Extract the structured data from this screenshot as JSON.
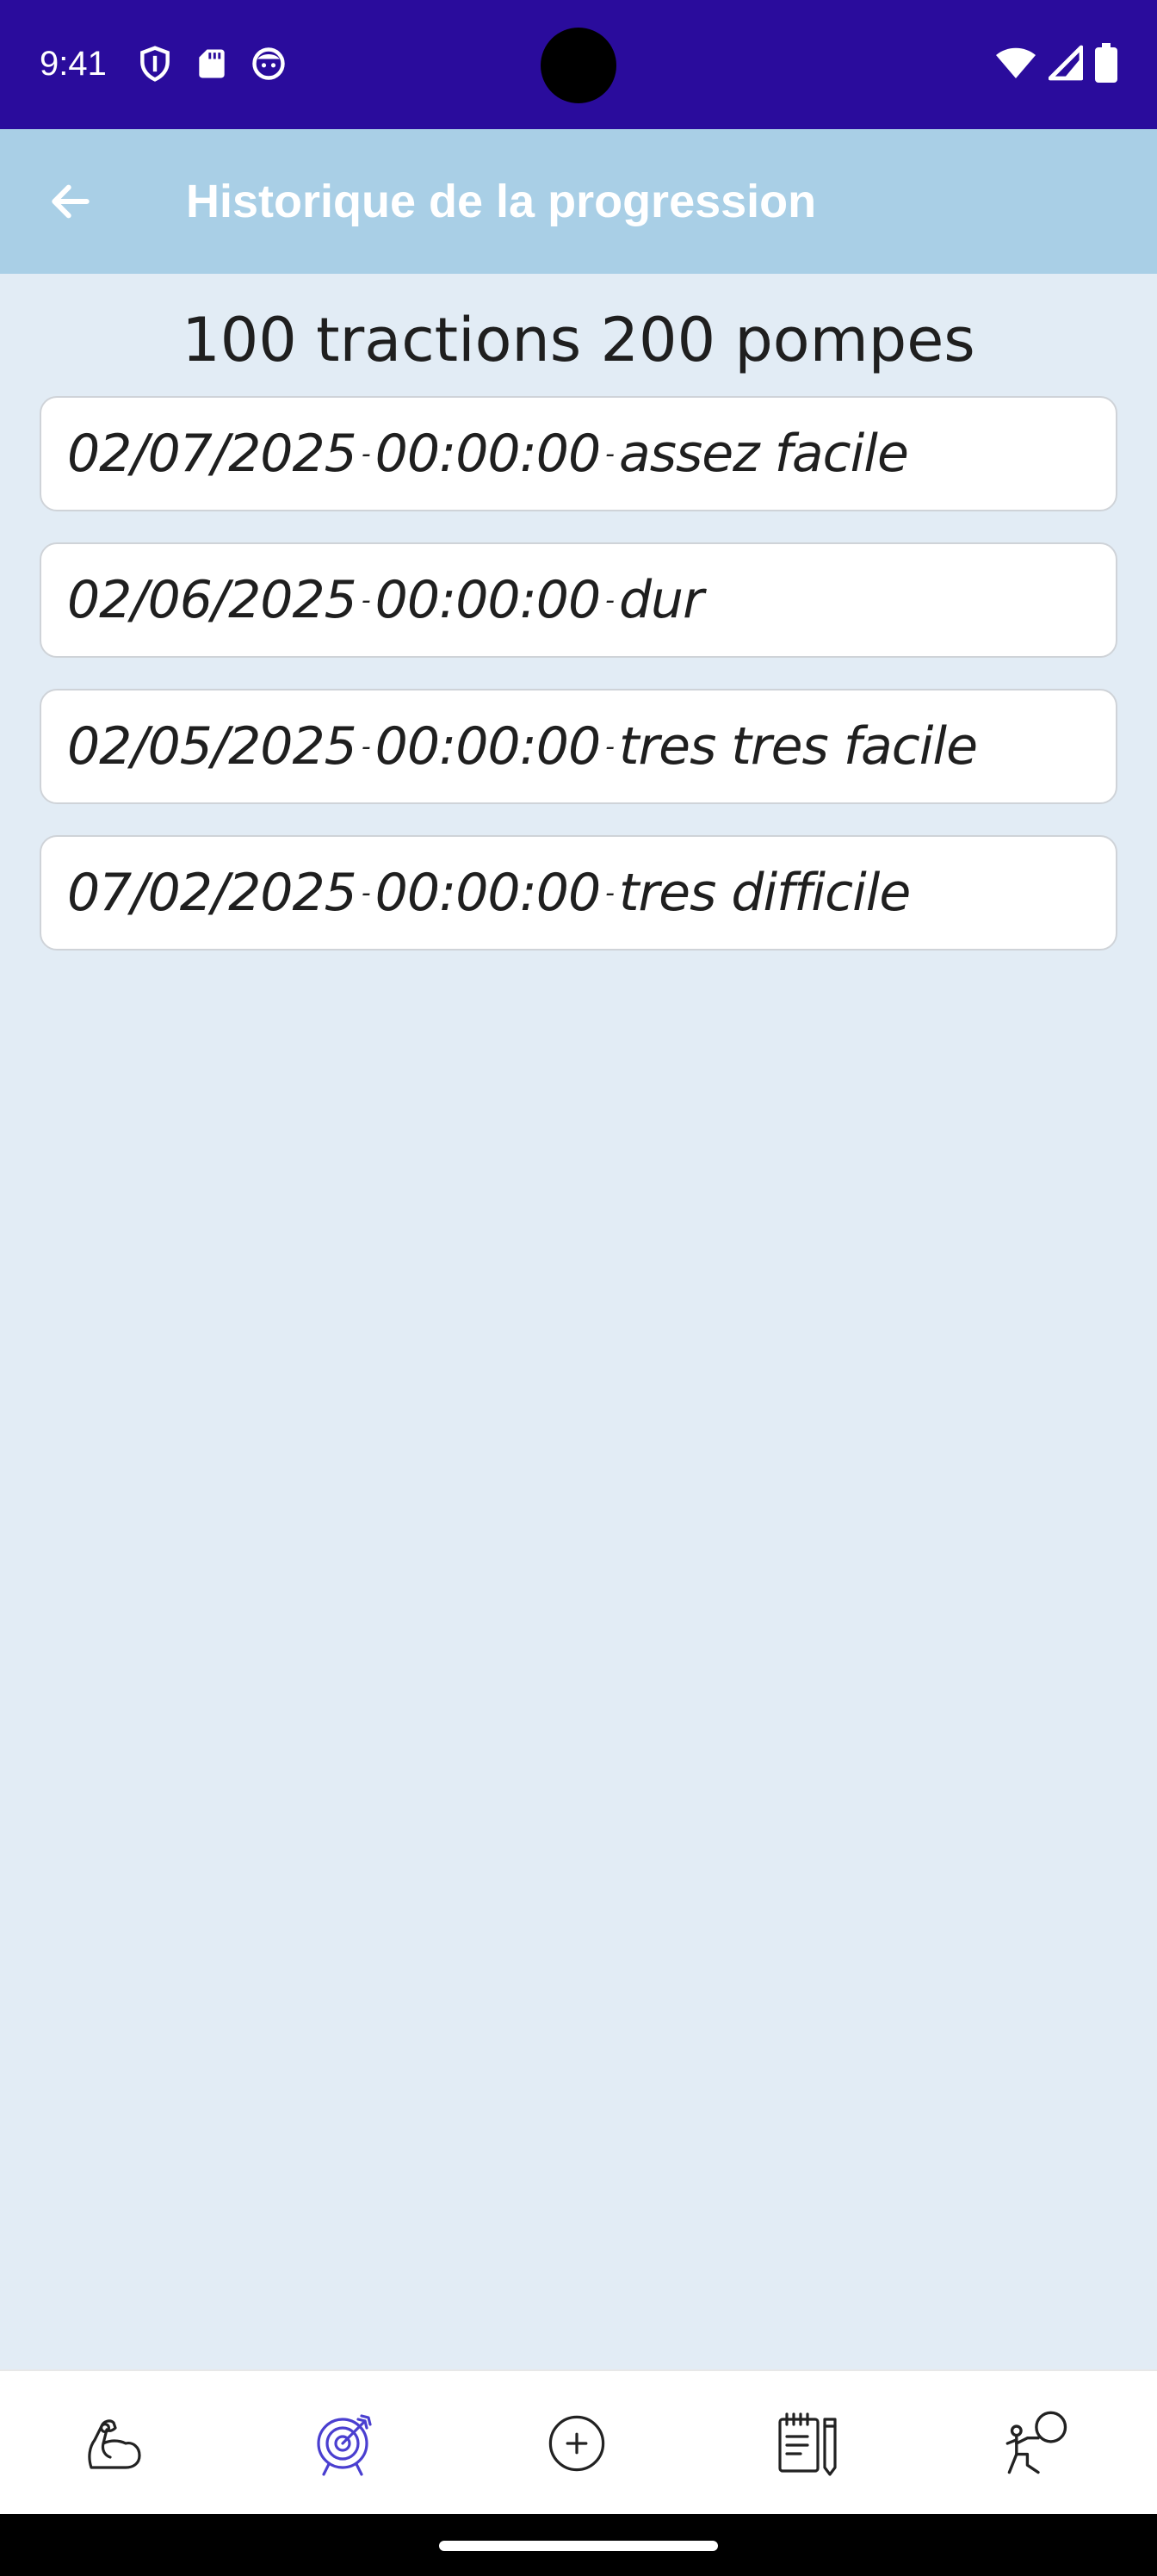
{
  "status_bar": {
    "time": "9:41",
    "left_icons": [
      "shield-icon",
      "sd-card-icon",
      "face-icon"
    ],
    "right_icons": [
      "wifi-icon",
      "signal-icon",
      "battery-icon"
    ]
  },
  "app_bar": {
    "back_icon": "arrow-left-icon",
    "title": "Historique de la progression",
    "background": "#a9cfe6"
  },
  "page": {
    "heading": "100 tractions 200 pompes"
  },
  "entries": [
    {
      "date": "02/07/2025",
      "time": "00:00:00",
      "rating": "assez facile"
    },
    {
      "date": "02/06/2025",
      "time": "00:00:00",
      "rating": "dur"
    },
    {
      "date": "02/05/2025",
      "time": "00:00:00",
      "rating": "tres tres facile"
    },
    {
      "date": "07/02/2025",
      "time": "00:00:00",
      "rating": "tres difficile"
    }
  ],
  "separator": "-",
  "bottom_nav": {
    "items": [
      {
        "icon": "muscle-icon",
        "active": false
      },
      {
        "icon": "target-icon",
        "active": true
      },
      {
        "icon": "add-circle-icon",
        "active": false
      },
      {
        "icon": "notepad-icon",
        "active": false
      },
      {
        "icon": "coach-icon",
        "active": false
      }
    ],
    "active_color": "#4a3fd0"
  }
}
